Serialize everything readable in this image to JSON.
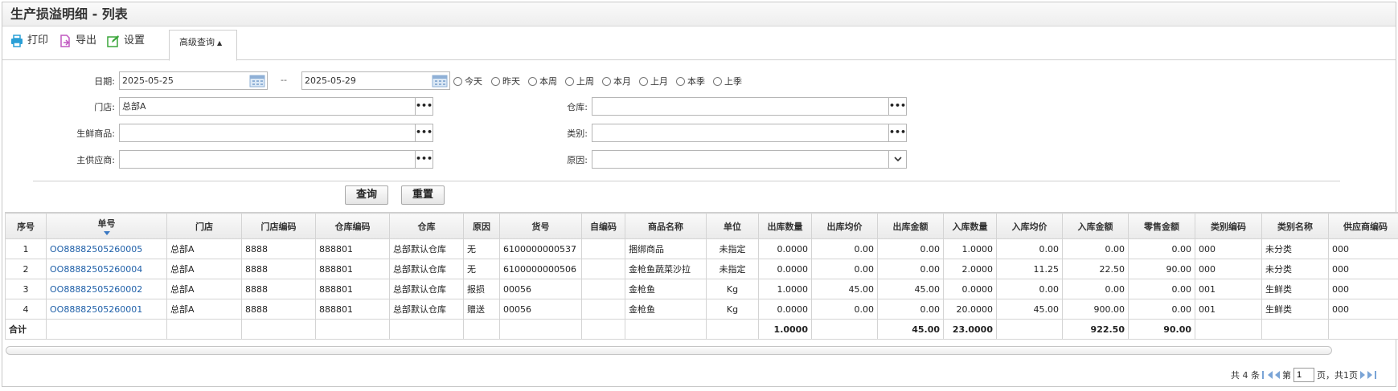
{
  "title": "生产损溢明细 - 列表",
  "toolbar": {
    "print": "打印",
    "export": "导出",
    "settings": "设置",
    "advanced": "高级查询"
  },
  "form": {
    "date_label": "日期:",
    "date_from": "2025-05-25",
    "date_sep": "--",
    "date_to": "2025-05-29",
    "quick_dates": [
      "今天",
      "昨天",
      "本周",
      "上周",
      "本月",
      "上月",
      "本季",
      "上季"
    ],
    "store_label": "门店:",
    "store_value": "总部A",
    "warehouse_label": "仓库:",
    "warehouse_value": "",
    "fresh_label": "生鲜商品:",
    "fresh_value": "",
    "category_label": "类别:",
    "category_value": "",
    "supplier_label": "主供应商:",
    "supplier_value": "",
    "reason_label": "原因:",
    "reason_value": "",
    "dots": "•••",
    "query_button": "查询",
    "reset_button": "重置"
  },
  "table": {
    "columns": [
      "序号",
      "单号",
      "门店",
      "门店编码",
      "仓库编码",
      "仓库",
      "原因",
      "货号",
      "自编码",
      "商品名称",
      "单位",
      "出库数量",
      "出库均价",
      "出库金额",
      "入库数量",
      "入库均价",
      "入库金额",
      "零售金额",
      "类别编码",
      "类别名称",
      "供应商编码"
    ],
    "rows": [
      [
        "1",
        "OO88882505260005",
        "总部A",
        "8888",
        "888801",
        "总部默认仓库",
        "无",
        "6100000000537",
        "",
        "捆绑商品",
        "未指定",
        "0.0000",
        "0.00",
        "0.00",
        "1.0000",
        "0.00",
        "0.00",
        "0.00",
        "000",
        "未分类",
        "000"
      ],
      [
        "2",
        "OO88882505260004",
        "总部A",
        "8888",
        "888801",
        "总部默认仓库",
        "无",
        "6100000000506",
        "",
        "金枪鱼蔬菜沙拉",
        "未指定",
        "0.0000",
        "0.00",
        "0.00",
        "2.0000",
        "11.25",
        "22.50",
        "90.00",
        "000",
        "未分类",
        "000"
      ],
      [
        "3",
        "OO88882505260002",
        "总部A",
        "8888",
        "888801",
        "总部默认仓库",
        "报损",
        "00056",
        "",
        "金枪鱼",
        "Kg",
        "1.0000",
        "45.00",
        "45.00",
        "0.0000",
        "0.00",
        "0.00",
        "0.00",
        "001",
        "生鲜类",
        "000"
      ],
      [
        "4",
        "OO88882505260001",
        "总部A",
        "8888",
        "888801",
        "总部默认仓库",
        "赠送",
        "00056",
        "",
        "金枪鱼",
        "Kg",
        "0.0000",
        "0.00",
        "0.00",
        "20.0000",
        "45.00",
        "900.00",
        "0.00",
        "001",
        "生鲜类",
        "000"
      ]
    ],
    "total": [
      "合计",
      "",
      "",
      "",
      "",
      "",
      "",
      "",
      "",
      "",
      "",
      "1.0000",
      "",
      "45.00",
      "23.0000",
      "",
      "922.50",
      "90.00",
      "",
      "",
      ""
    ]
  },
  "pager": {
    "total_text": "共 4 条",
    "page_prefix": "第",
    "page_value": "1",
    "page_suffix": "页，共1页"
  },
  "colors": {
    "link": "#1e5fa8",
    "print_icon": "#2a9fd6",
    "export_icon": "#c158c1",
    "settings_icon": "#3aa63a"
  }
}
